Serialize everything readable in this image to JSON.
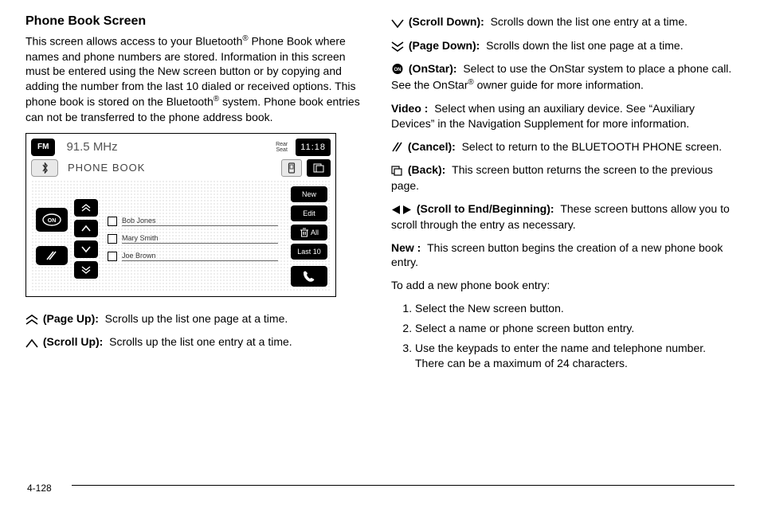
{
  "page_number": "4-128",
  "section": {
    "title": "Phone Book Screen",
    "intro_1": "This screen allows access to your Bluetooth",
    "intro_reg1": "®",
    "intro_2": " Phone Book where names and phone numbers are stored. Information in this screen must be entered using the New screen button or by copying and adding the number from the last 10 dialed or received options. This phone book is stored on the Bluetooth",
    "intro_reg2": "®",
    "intro_3": " system. Phone book entries can not be transferred to the phone address book."
  },
  "diagram": {
    "band": "FM",
    "frequency": "91.5 MHz",
    "rear_seat": "Rear\nSeat",
    "time": "11:18",
    "title": "PHONE BOOK",
    "entries": [
      "Bob Jones",
      "Mary Smith",
      "Joe Brown"
    ],
    "side_buttons": {
      "new": "New",
      "edit": "Edit",
      "all": "All",
      "last10": "Last 10"
    }
  },
  "definitions_left": {
    "page_up": {
      "label": "(Page Up):",
      "text": "Scrolls up the list one page at a time."
    },
    "scroll_up": {
      "label": "(Scroll Up):",
      "text": "Scrolls up the list one entry at a time."
    }
  },
  "definitions_right": {
    "scroll_down": {
      "label": "(Scroll Down):",
      "text": "Scrolls down the list one entry at a time."
    },
    "page_down": {
      "label": "(Page Down):",
      "text": "Scrolls down the list one page at a time."
    },
    "onstar": {
      "label": "(OnStar):",
      "text_1": "Select to use the OnStar system to place a phone call. See the OnStar",
      "reg": "®",
      "text_2": " owner guide for more information."
    },
    "video": {
      "label": "Video :",
      "text": "Select when using an auxiliary device. See “Auxiliary Devices” in the Navigation Supplement for more information."
    },
    "cancel": {
      "label": "(Cancel):",
      "text": "Select to return to the BLUETOOTH PHONE screen."
    },
    "back": {
      "label": "(Back):",
      "text": "This screen button returns the screen to the previous page."
    },
    "scroll_end": {
      "label": "(Scroll to End/Beginning):",
      "text": "These screen buttons allow you to scroll through the entry as necessary."
    },
    "new": {
      "label": "New :",
      "text": "This screen button begins the creation of a new phone book entry."
    },
    "add_intro": "To add a new phone book entry:",
    "steps": [
      "Select the New screen button.",
      "Select a name or phone screen button entry.",
      "Use the keypads to enter the name and telephone number. There can be a maximum of 24 characters."
    ]
  }
}
